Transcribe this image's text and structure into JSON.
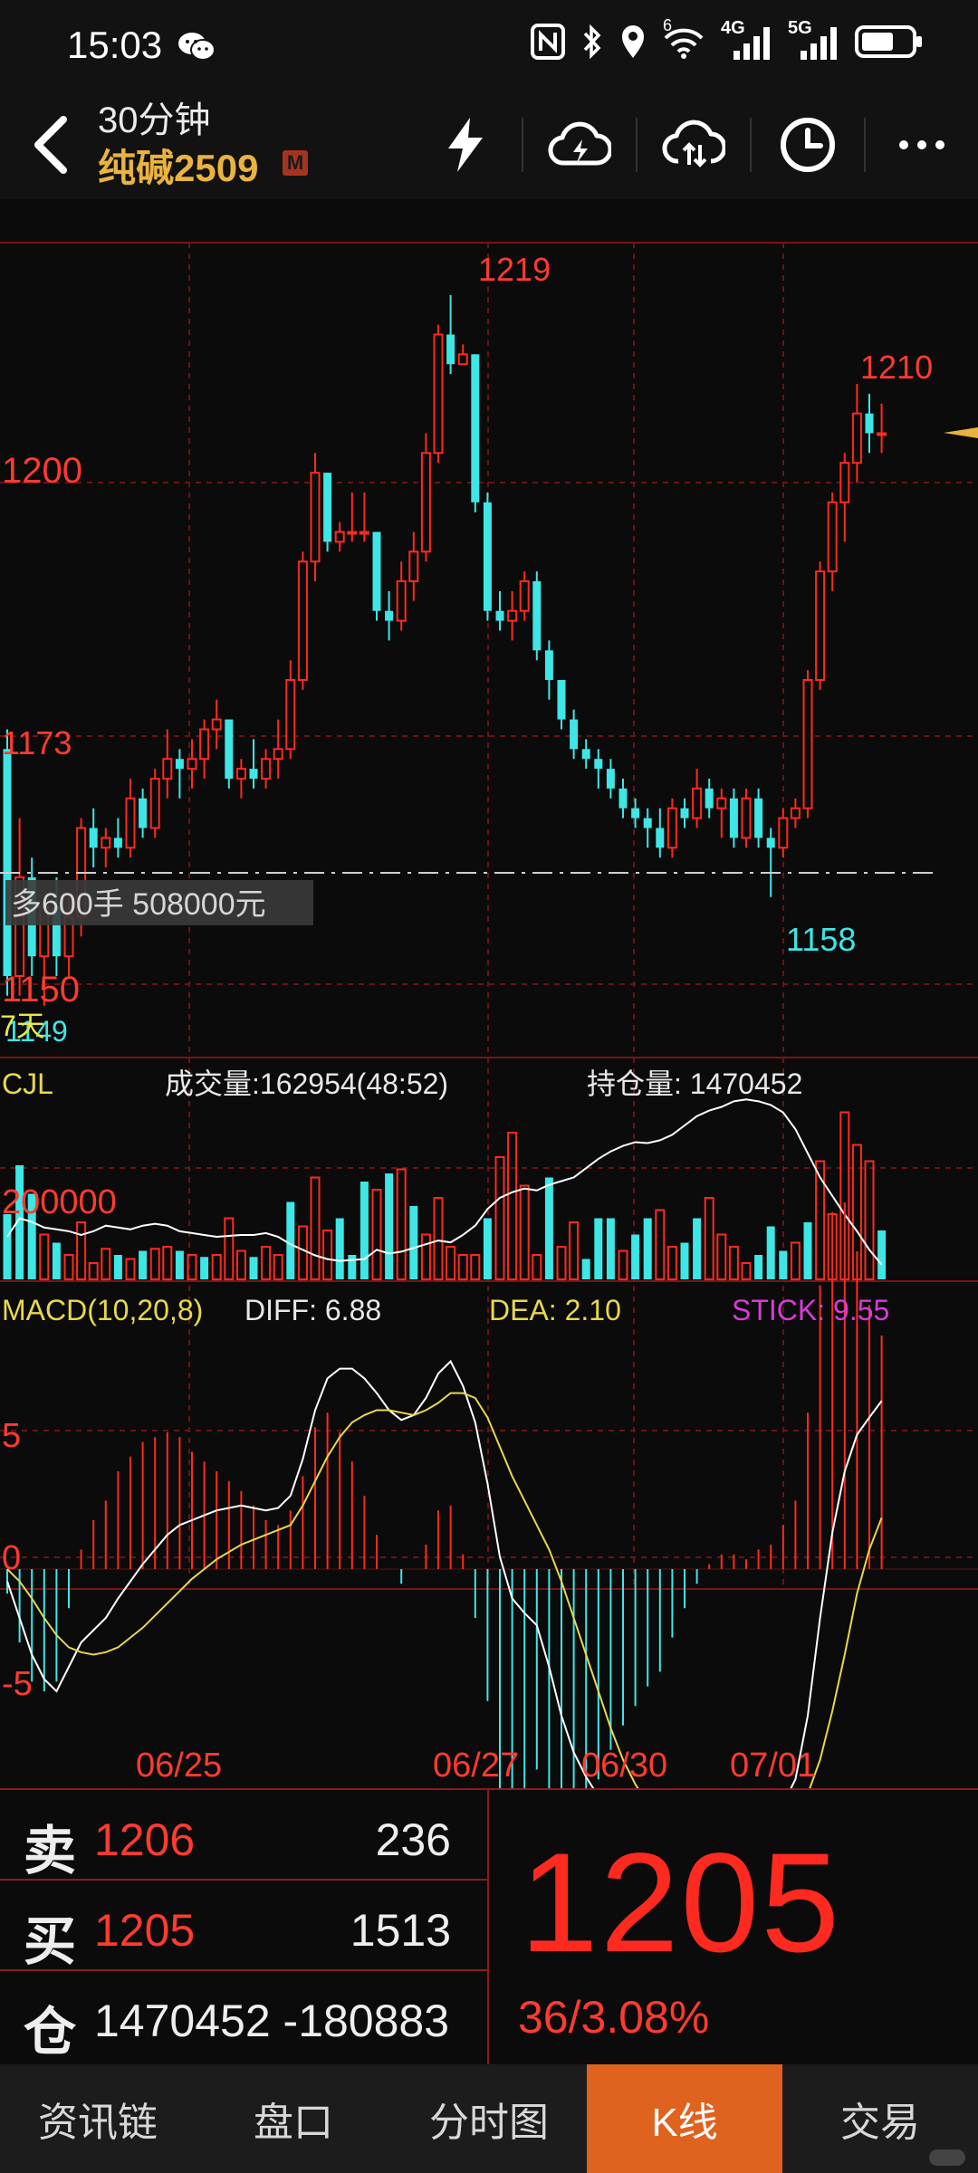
{
  "status_bar": {
    "time": "15:03",
    "icons": [
      "wechat-icon",
      "nfc-icon",
      "bluetooth-icon",
      "location-icon",
      "wifi-icon",
      "signal-4g-icon",
      "signal-5g-icon",
      "battery-icon"
    ],
    "wifi_label": "6",
    "net1": "4G",
    "net2": "5G"
  },
  "app_bar": {
    "period": "30分钟",
    "symbol": "纯碱2509",
    "badge": "M",
    "toolbar_icons": [
      "lightning-icon",
      "cloud-lightning-icon",
      "cloud-sync-icon",
      "clock-icon",
      "more-icon"
    ]
  },
  "chart_data": [
    {
      "type": "candlestick",
      "price_labels": [
        "1200",
        "1173",
        "1150",
        "1149"
      ],
      "ylim": [
        1147,
        1225
      ],
      "annotations": {
        "high": "1219",
        "high2": "1210",
        "low": "1158"
      },
      "position_line": {
        "price": 1166,
        "label": "多600手 508000元"
      },
      "badge_text": "7天",
      "candles": [
        [
          1173,
          1175,
          1148,
          1150
        ],
        [
          1150,
          1166,
          1148,
          1160
        ],
        [
          1160,
          1162,
          1150,
          1152
        ],
        [
          1152,
          1158,
          1147,
          1157
        ],
        [
          1157,
          1160,
          1150,
          1152
        ],
        [
          1152,
          1158,
          1150,
          1156
        ],
        [
          1156,
          1166,
          1154,
          1165
        ],
        [
          1165,
          1167,
          1161,
          1163
        ],
        [
          1163,
          1165,
          1161,
          1164
        ],
        [
          1164,
          1166,
          1162,
          1163
        ],
        [
          1163,
          1170,
          1162,
          1168
        ],
        [
          1168,
          1169,
          1164,
          1165
        ],
        [
          1165,
          1171,
          1164,
          1170
        ],
        [
          1170,
          1175,
          1168,
          1172
        ],
        [
          1172,
          1173,
          1168,
          1171
        ],
        [
          1171,
          1174,
          1169,
          1172
        ],
        [
          1172,
          1176,
          1170,
          1175
        ],
        [
          1175,
          1178,
          1173,
          1176
        ],
        [
          1176,
          1176,
          1169,
          1170
        ],
        [
          1170,
          1172,
          1168,
          1171
        ],
        [
          1171,
          1174,
          1169,
          1170
        ],
        [
          1170,
          1173,
          1169,
          1172
        ],
        [
          1172,
          1176,
          1170,
          1173
        ],
        [
          1173,
          1182,
          1172,
          1180
        ],
        [
          1180,
          1193,
          1179,
          1192
        ],
        [
          1192,
          1203,
          1190,
          1201
        ],
        [
          1201,
          1201,
          1193,
          1194
        ],
        [
          1194,
          1196,
          1193,
          1195
        ],
        [
          1195,
          1199,
          1194,
          1195
        ],
        [
          1195,
          1199,
          1194,
          1195
        ],
        [
          1195,
          1195,
          1186,
          1187
        ],
        [
          1187,
          1189,
          1184,
          1186
        ],
        [
          1186,
          1192,
          1185,
          1190
        ],
        [
          1190,
          1195,
          1188,
          1193
        ],
        [
          1193,
          1205,
          1192,
          1203
        ],
        [
          1203,
          1216,
          1202,
          1215
        ],
        [
          1215,
          1219,
          1211,
          1212
        ],
        [
          1212,
          1214,
          1212,
          1213
        ],
        [
          1213,
          1213,
          1197,
          1198
        ],
        [
          1198,
          1199,
          1186,
          1187
        ],
        [
          1187,
          1189,
          1185,
          1186
        ],
        [
          1186,
          1189,
          1184,
          1187
        ],
        [
          1187,
          1191,
          1186,
          1190
        ],
        [
          1190,
          1191,
          1182,
          1183
        ],
        [
          1183,
          1184,
          1178,
          1180
        ],
        [
          1180,
          1180,
          1175,
          1176
        ],
        [
          1176,
          1177,
          1172,
          1173
        ],
        [
          1173,
          1174,
          1171,
          1172
        ],
        [
          1172,
          1173,
          1169,
          1171
        ],
        [
          1171,
          1172,
          1168,
          1169
        ],
        [
          1169,
          1170,
          1166,
          1167
        ],
        [
          1167,
          1168,
          1165,
          1166
        ],
        [
          1166,
          1167,
          1163,
          1165
        ],
        [
          1165,
          1167,
          1162,
          1163
        ],
        [
          1163,
          1168,
          1162,
          1167
        ],
        [
          1167,
          1168,
          1165,
          1166
        ],
        [
          1166,
          1171,
          1165,
          1169
        ],
        [
          1169,
          1170,
          1166,
          1167
        ],
        [
          1167,
          1169,
          1164,
          1168
        ],
        [
          1168,
          1169,
          1163,
          1164
        ],
        [
          1164,
          1169,
          1163,
          1168
        ],
        [
          1168,
          1169,
          1163,
          1164
        ],
        [
          1164,
          1165,
          1158,
          1163
        ],
        [
          1163,
          1167,
          1162,
          1166
        ],
        [
          1166,
          1168,
          1165,
          1167
        ],
        [
          1167,
          1181,
          1166,
          1180
        ],
        [
          1180,
          1192,
          1179,
          1191
        ],
        [
          1191,
          1199,
          1189,
          1198
        ],
        [
          1198,
          1203,
          1194,
          1202
        ],
        [
          1202,
          1210,
          1200,
          1207
        ],
        [
          1207,
          1209,
          1203,
          1205
        ],
        [
          1205,
          1208,
          1203,
          1205
        ]
      ]
    },
    {
      "type": "bar",
      "label": "CJL",
      "volume_label": "成交量:162954(48:52)",
      "oi_label": "持仓量: 1470452",
      "tick_label": "200000",
      "volume": [
        [
          160,
          "d"
        ],
        [
          280,
          "d"
        ],
        [
          210,
          "d"
        ],
        [
          110,
          "u"
        ],
        [
          90,
          "d"
        ],
        [
          60,
          "u"
        ],
        [
          140,
          "u"
        ],
        [
          40,
          "u"
        ],
        [
          75,
          "u"
        ],
        [
          60,
          "d"
        ],
        [
          50,
          "u"
        ],
        [
          70,
          "d"
        ],
        [
          75,
          "u"
        ],
        [
          80,
          "u"
        ],
        [
          70,
          "d"
        ],
        [
          60,
          "u"
        ],
        [
          55,
          "d"
        ],
        [
          60,
          "u"
        ],
        [
          150,
          "u"
        ],
        [
          70,
          "u"
        ],
        [
          55,
          "d"
        ],
        [
          80,
          "u"
        ],
        [
          60,
          "u"
        ],
        [
          190,
          "d"
        ],
        [
          130,
          "u"
        ],
        [
          250,
          "u"
        ],
        [
          120,
          "u"
        ],
        [
          150,
          "d"
        ],
        [
          60,
          "d"
        ],
        [
          240,
          "d"
        ],
        [
          220,
          "u"
        ],
        [
          260,
          "d"
        ],
        [
          270,
          "u"
        ],
        [
          180,
          "d"
        ],
        [
          110,
          "u"
        ],
        [
          200,
          "u"
        ],
        [
          80,
          "u"
        ],
        [
          60,
          "u"
        ],
        [
          60,
          "u"
        ],
        [
          150,
          "d"
        ],
        [
          300,
          "u"
        ],
        [
          360,
          "u"
        ],
        [
          230,
          "u"
        ],
        [
          60,
          "u"
        ],
        [
          250,
          "d"
        ],
        [
          80,
          "u"
        ],
        [
          140,
          "u"
        ],
        [
          50,
          "d"
        ],
        [
          150,
          "d"
        ],
        [
          150,
          "d"
        ],
        [
          70,
          "u"
        ],
        [
          110,
          "d"
        ],
        [
          150,
          "d"
        ],
        [
          170,
          "u"
        ],
        [
          80,
          "u"
        ],
        [
          90,
          "d"
        ],
        [
          150,
          "d"
        ],
        [
          200,
          "u"
        ],
        [
          110,
          "u"
        ],
        [
          80,
          "u"
        ],
        [
          40,
          "u"
        ],
        [
          60,
          "d"
        ],
        [
          130,
          "d"
        ],
        [
          70,
          "d"
        ],
        [
          90,
          "u"
        ],
        [
          140,
          "d"
        ],
        [
          290,
          "u"
        ],
        [
          160,
          "u"
        ],
        [
          410,
          "u"
        ],
        [
          330,
          "u"
        ],
        [
          290,
          "u"
        ],
        [
          120,
          "d"
        ]
      ],
      "open_interest": [
        1440000,
        1450000,
        1448000,
        1445000,
        1444000,
        1443000,
        1441000,
        1443000,
        1446000,
        1445000,
        1444000,
        1446000,
        1447000,
        1446000,
        1443000,
        1442000,
        1441000,
        1440000,
        1440500,
        1441000,
        1441000,
        1442000,
        1440000,
        1436000,
        1433000,
        1430000,
        1428000,
        1427000,
        1427500,
        1428000,
        1433000,
        1431000,
        1432000,
        1434000,
        1436000,
        1438000,
        1437000,
        1441000,
        1446000,
        1455000,
        1461000,
        1464000,
        1466000,
        1465000,
        1468000,
        1470000,
        1472000,
        1477000,
        1482000,
        1486000,
        1489000,
        1491000,
        1490500,
        1492000,
        1495000,
        1500000,
        1505000,
        1508000,
        1510000,
        1513000,
        1514000,
        1513000,
        1511000,
        1507000,
        1498000,
        1485000,
        1472000,
        1462000,
        1452000,
        1443000,
        1433000,
        1425000
      ]
    },
    {
      "type": "line",
      "label": "MACD(10,20,8)",
      "diff_label": "DIFF: 6.88",
      "dea_label": "DEA: 2.10",
      "stick_label": "STICK: 9.55",
      "tick_labels": [
        "5",
        "0",
        "-5"
      ],
      "ylim": [
        -13,
        11
      ],
      "diff": [
        -0.5,
        -2,
        -3.5,
        -4.5,
        -5,
        -4,
        -3,
        -2.5,
        -2,
        -1.2,
        -0.5,
        0.2,
        0.8,
        1.4,
        1.8,
        2,
        2.2,
        2.4,
        2.5,
        2.6,
        2.5,
        2.4,
        2.5,
        3,
        4.5,
        6.5,
        7.8,
        8.2,
        8.2,
        7.8,
        7.2,
        6.5,
        6.1,
        6.3,
        7,
        8,
        8.5,
        7.5,
        6,
        3.5,
        0.5,
        -1.2,
        -1.8,
        -2.3,
        -4,
        -6,
        -7.5,
        -8.5,
        -9.3,
        -10.2,
        -11,
        -11.6,
        -12,
        -12.3,
        -12,
        -11.6,
        -11.2,
        -10.8,
        -10.6,
        -10.6,
        -10.6,
        -10.4,
        -10.2,
        -9.6,
        -8.6,
        -6,
        -2,
        1.5,
        4,
        5.5,
        6.2,
        6.88
      ],
      "dea": [
        0,
        -0.5,
        -1.2,
        -2,
        -2.7,
        -3.2,
        -3.4,
        -3.5,
        -3.4,
        -3.2,
        -2.8,
        -2.4,
        -1.9,
        -1.4,
        -0.9,
        -0.4,
        0,
        0.4,
        0.7,
        1,
        1.2,
        1.4,
        1.6,
        1.8,
        2.6,
        3.6,
        4.6,
        5.4,
        6,
        6.3,
        6.5,
        6.5,
        6.4,
        6.3,
        6.5,
        6.8,
        7.2,
        7.2,
        7,
        6.2,
        5,
        3.8,
        2.8,
        1.8,
        0.8,
        -0.5,
        -2,
        -3.5,
        -5,
        -6.5,
        -7.8,
        -8.8,
        -9.6,
        -10.2,
        -10.6,
        -10.8,
        -10.9,
        -10.9,
        -10.9,
        -10.9,
        -10.8,
        -10.8,
        -10.7,
        -10.5,
        -10,
        -9.2,
        -7.8,
        -5.8,
        -3.5,
        -1,
        0.8,
        2.1
      ],
      "stick": [
        -1,
        -3,
        -4.6,
        -5,
        -4.6,
        -1.6,
        0.8,
        2,
        2.8,
        4,
        4.6,
        5.2,
        5.4,
        5.6,
        5.4,
        4.8,
        4.4,
        4,
        3.6,
        3.2,
        2.6,
        2,
        1.8,
        2.4,
        3.8,
        5.8,
        6.4,
        5.6,
        4.4,
        3,
        1.4,
        0,
        -0.6,
        0,
        1,
        2.4,
        2.6,
        0.6,
        -2,
        -5.4,
        -9,
        -10,
        -9.2,
        -8.2,
        -9.6,
        -11,
        -11,
        -10,
        -8.6,
        -7.4,
        -6.4,
        -5.6,
        -4.8,
        -4.2,
        -2.8,
        -1.6,
        -0.6,
        0.2,
        0.6,
        0.6,
        0.4,
        0.8,
        1,
        1.8,
        2.8,
        6.4,
        11.6,
        14.6,
        15,
        13,
        10.8,
        9.55
      ]
    }
  ],
  "x_dates": [
    "06/25",
    "06/27",
    "06/30",
    "07/01"
  ],
  "quote": {
    "sell_key": "卖",
    "sell_price": "1206",
    "sell_vol": "236",
    "buy_key": "买",
    "buy_price": "1205",
    "buy_vol": "1513",
    "oi_key": "仓",
    "oi_value": "1470452 -180883",
    "last_price": "1205",
    "change": "36/3.08%"
  },
  "tabs": [
    "资讯链",
    "盘口",
    "分时图",
    "K线",
    "交易"
  ],
  "active_tab": "K线",
  "colors": {
    "up": "#ff2a1f",
    "down": "#3ee6e6",
    "grid": "#7a1414",
    "diff": "#ffffff",
    "dea": "#e8d84a",
    "stick_label": "#d83ad8",
    "gold": "#e9b33e",
    "active_tab": "#e0621f"
  }
}
